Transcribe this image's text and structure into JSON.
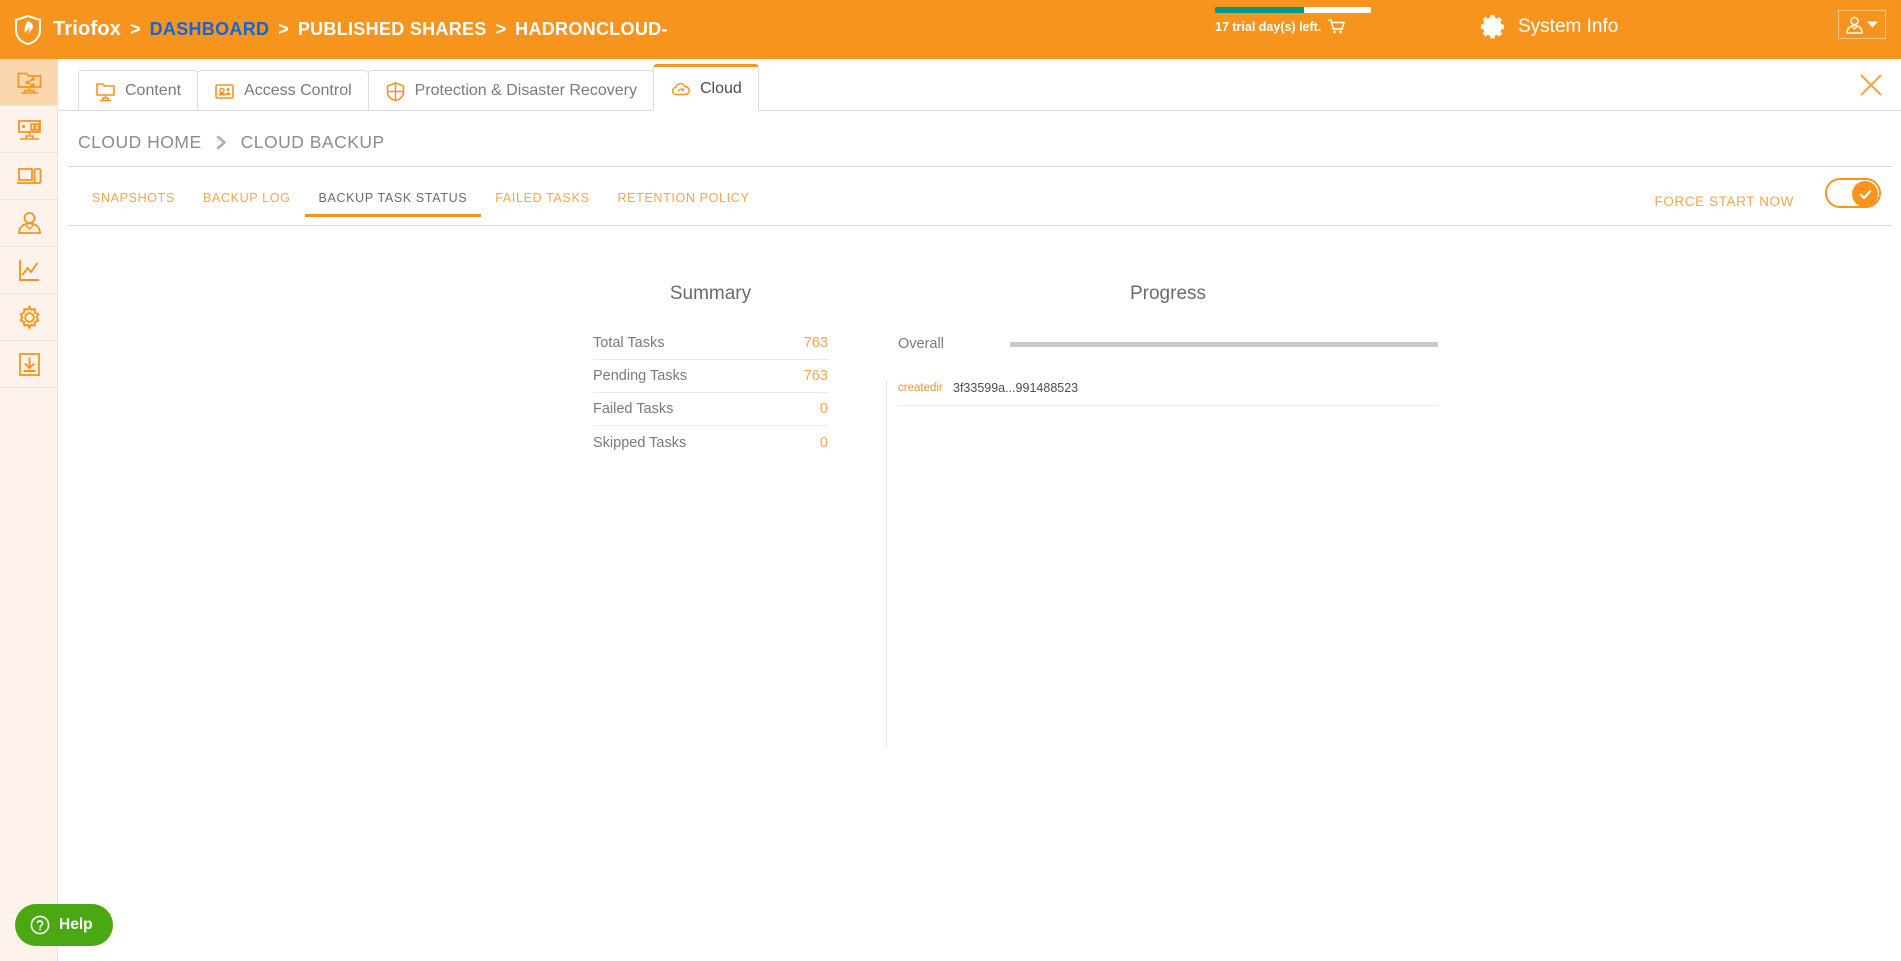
{
  "topbar": {
    "brand": "Triofox",
    "logo_icon": "shield-logo-icon",
    "breadcrumb": [
      {
        "label": "DASHBOARD",
        "style": "link"
      },
      {
        "label": "PUBLISHED SHARES",
        "style": "plain"
      },
      {
        "label": "HADRONCLOUD-",
        "style": "plain"
      }
    ],
    "separator": ">",
    "trial": {
      "text": "17 trial day(s) left.",
      "percent": 57,
      "fill_color": "#009688",
      "track_color": "#ffffff",
      "cart_icon": "shopping-cart-icon"
    },
    "system_info": {
      "label": "System Info",
      "icon": "gear-icon"
    },
    "user_menu": {
      "avatar_icon": "user-avatar-icon",
      "caret_icon": "chevron-down-icon"
    },
    "background_color": "#f7941e"
  },
  "sidebar": {
    "items": [
      {
        "name": "shared-folders",
        "icon": "shared-folder-network-icon",
        "active": true
      },
      {
        "name": "servers",
        "icon": "server-icon",
        "active": false
      },
      {
        "name": "devices",
        "icon": "devices-icon",
        "active": false
      },
      {
        "name": "users",
        "icon": "user-icon",
        "active": false
      },
      {
        "name": "reports",
        "icon": "chart-line-icon",
        "active": false
      },
      {
        "name": "settings",
        "icon": "gear-icon",
        "active": false
      },
      {
        "name": "downloads",
        "icon": "download-icon",
        "active": false
      }
    ]
  },
  "panel": {
    "close_icon": "close-icon",
    "tabs": [
      {
        "label": "Content",
        "icon": "folder-monitor-icon",
        "active": false
      },
      {
        "label": "Access Control",
        "icon": "access-control-icon",
        "active": false
      },
      {
        "label": "Protection & Disaster Recovery",
        "icon": "shield-protection-icon",
        "active": false
      },
      {
        "label": "Cloud",
        "icon": "cloud-sync-icon",
        "active": true
      }
    ],
    "breadcrumb": [
      {
        "label": "CLOUD HOME"
      },
      {
        "label": "CLOUD BACKUP"
      }
    ],
    "breadcrumb_chevron_icon": "chevron-right-icon",
    "subtabs": [
      {
        "label": "SNAPSHOTS",
        "active": false
      },
      {
        "label": "BACKUP LOG",
        "active": false
      },
      {
        "label": "BACKUP TASK STATUS",
        "active": true
      },
      {
        "label": "FAILED TASKS",
        "active": false
      },
      {
        "label": "RETENTION POLICY",
        "active": false
      }
    ],
    "force_start_label": "FORCE START NOW",
    "toggle": {
      "state": "on",
      "icon": "check-icon",
      "color": "#f7941e"
    }
  },
  "summary": {
    "title": "Summary",
    "rows": [
      {
        "label": "Total Tasks",
        "value": "763"
      },
      {
        "label": "Pending Tasks",
        "value": "763"
      },
      {
        "label": "Failed Tasks",
        "value": "0"
      },
      {
        "label": "Skipped Tasks",
        "value": "0"
      }
    ]
  },
  "progress": {
    "title": "Progress",
    "overall": {
      "label": "Overall",
      "percent": 0
    },
    "current_task": {
      "operation": "createdir",
      "id": "3f33599a...991488523"
    }
  },
  "help": {
    "label": "Help",
    "icon": "question-circle-icon",
    "color": "#4aa812"
  },
  "accent_color": "#f7941e"
}
